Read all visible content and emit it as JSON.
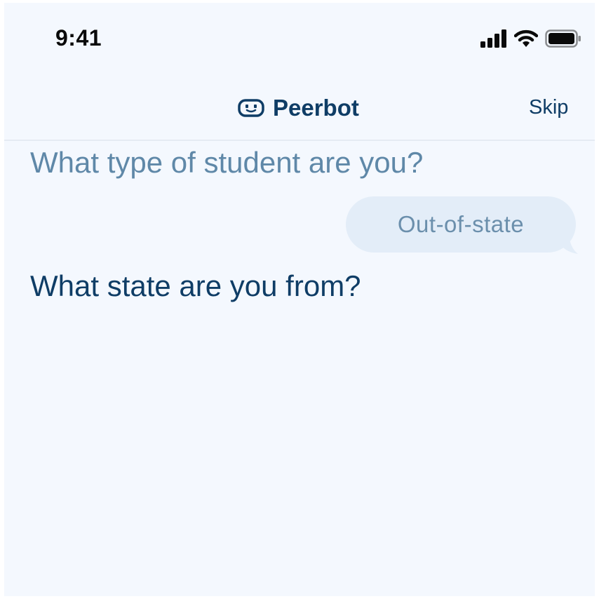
{
  "status_bar": {
    "time": "9:41",
    "icons": [
      "signal-icon",
      "wifi-icon",
      "battery-icon"
    ]
  },
  "header": {
    "title": "Peerbot",
    "logo_icon": "robot-face-icon",
    "skip_label": "Skip"
  },
  "chat": {
    "previous_question": "What type of student are you?",
    "answer": "Out-of-state",
    "current_question": "What state are you from?"
  },
  "colors": {
    "background": "#f4f8fe",
    "primary_text": "#0f3d66",
    "muted_text": "#5f88a8",
    "bubble": "#e3edf8"
  }
}
